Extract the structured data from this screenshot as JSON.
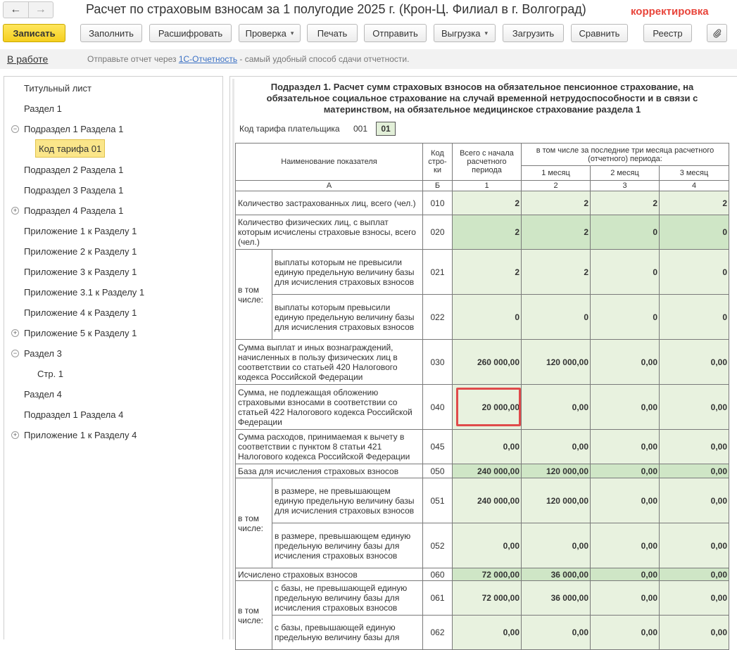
{
  "window": {
    "title": "Расчет по страховым взносам за 1 полугодие 2025 г. (Крон-Ц. Филиал в г. Волгоград)",
    "correction_label": "корректировка"
  },
  "nav": {
    "back": "←",
    "forward": "→"
  },
  "toolbar": {
    "save": "Записать",
    "fill": "Заполнить",
    "decode": "Расшифровать",
    "check": "Проверка",
    "print": "Печать",
    "send": "Отправить",
    "export": "Выгрузка",
    "load": "Загрузить",
    "compare": "Сравнить",
    "registry": "Реестр",
    "caret": "▾",
    "attach_icon": "paperclip-icon"
  },
  "infobar": {
    "status": "В работе",
    "text_before": "Отправьте отчет через ",
    "link": "1С-Отчетность",
    "text_after": " - самый удобный способ сдачи отчетности."
  },
  "tree": [
    {
      "label": "Титульный лист"
    },
    {
      "label": "Раздел 1"
    },
    {
      "label": "Подраздел 1 Раздела 1",
      "expander": "⊖"
    },
    {
      "label": "Код тарифа 01",
      "selected": true
    },
    {
      "label": "Подраздел 2 Раздела 1"
    },
    {
      "label": "Подраздел 3 Раздела 1"
    },
    {
      "label": "Подраздел 4 Раздела 1",
      "expander": "⊕"
    },
    {
      "label": "Приложение 1 к Разделу 1"
    },
    {
      "label": "Приложение 2 к Разделу 1"
    },
    {
      "label": "Приложение 3 к Разделу 1"
    },
    {
      "label": "Приложение 3.1 к Разделу 1"
    },
    {
      "label": "Приложение 4 к Разделу 1"
    },
    {
      "label": "Приложение 5 к Разделу 1",
      "expander": "⊕"
    },
    {
      "label": "Раздел 3",
      "expander": "⊖"
    },
    {
      "label": "Стр. 1"
    },
    {
      "label": "Раздел 4"
    },
    {
      "label": "Подраздел 1 Раздела 4"
    },
    {
      "label": "Приложение 1 к Разделу 4",
      "expander": "⊕"
    }
  ],
  "report": {
    "heading": "Подраздел 1. Расчет сумм страховых взносов на обязательное пенсионное страхование, на обязательное социальное страхование на случай временной нетрудоспособности и в связи с материнством, на обязательное медицинское страхование раздела 1",
    "tariff_label": "Код тарифа плательщика",
    "tariff_code": "001",
    "tariff_value": "01",
    "headers": {
      "name": "Наименование показателя",
      "code": "Код стро-ки",
      "total": "Всего с начала расчетного периода",
      "last3": "в том числе за последние три месяца расчетного (отчетного) периода:",
      "m1": "1 месяц",
      "m2": "2 месяц",
      "m3": "3 месяц",
      "colA": "А",
      "colB": "Б",
      "c1": "1",
      "c2": "2",
      "c3": "3",
      "c4": "4"
    },
    "incl_label": "в том числе:",
    "rows": {
      "r010": {
        "name": "Количество застрахованных лиц, всего (чел.)",
        "code": "010",
        "v": [
          "2",
          "2",
          "2",
          "2"
        ]
      },
      "r020": {
        "name": "Количество физических лиц, с выплат которым исчислены страховые взносы, всего (чел.)",
        "code": "020",
        "v": [
          "2",
          "2",
          "0",
          "0"
        ]
      },
      "r021": {
        "name": "выплаты которым не превысили единую предельную величину базы для исчисления страховых взносов",
        "code": "021",
        "v": [
          "2",
          "2",
          "0",
          "0"
        ]
      },
      "r022": {
        "name": "выплаты которым превысили единую предельную величину базы для исчисления страховых взносов",
        "code": "022",
        "v": [
          "0",
          "0",
          "0",
          "0"
        ]
      },
      "r030": {
        "name": "Сумма выплат и иных вознаграждений, начисленных в пользу физических лиц в соответствии со статьей 420 Налогового кодекса Российской Федерации",
        "code": "030",
        "v": [
          "260 000,00",
          "120 000,00",
          "0,00",
          "0,00"
        ]
      },
      "r040": {
        "name": "Сумма, не подлежащая обложению страховыми взносами в соответствии со статьей 422 Налогового кодекса Российской Федерации",
        "code": "040",
        "v": [
          "20 000,00",
          "0,00",
          "0,00",
          "0,00"
        ]
      },
      "r045": {
        "name": "Сумма расходов, принимаемая к вычету в соответствии с пунктом 8 статьи 421 Налогового кодекса Российской Федерации",
        "code": "045",
        "v": [
          "0,00",
          "0,00",
          "0,00",
          "0,00"
        ]
      },
      "r050": {
        "name": "База для исчисления страховых взносов",
        "code": "050",
        "v": [
          "240 000,00",
          "120 000,00",
          "0,00",
          "0,00"
        ]
      },
      "r051": {
        "name": "в размере, не превышающем единую предельную величину базы для исчисления страховых взносов",
        "code": "051",
        "v": [
          "240 000,00",
          "120 000,00",
          "0,00",
          "0,00"
        ]
      },
      "r052": {
        "name": "в размере, превышающем единую предельную величину базы для исчисления страховых взносов",
        "code": "052",
        "v": [
          "0,00",
          "0,00",
          "0,00",
          "0,00"
        ]
      },
      "r060": {
        "name": "Исчислено страховых взносов",
        "code": "060",
        "v": [
          "72 000,00",
          "36 000,00",
          "0,00",
          "0,00"
        ]
      },
      "r061": {
        "name": "с базы, не превышающей единую предельную величину базы для исчисления страховых взносов",
        "code": "061",
        "v": [
          "72 000,00",
          "36 000,00",
          "0,00",
          "0,00"
        ]
      },
      "r062": {
        "name": "с базы, превышающей единую предельную величину базы для",
        "code": "062",
        "v": [
          "0,00",
          "0,00",
          "0,00",
          "0,00"
        ]
      }
    }
  },
  "colors": {
    "accent_yellow": "#f5cf1f",
    "correction_red": "#e8443a",
    "cell_green": "#e8f2df",
    "cell_dark_green": "#cfe6c6",
    "highlight_red": "#e04b4b"
  }
}
